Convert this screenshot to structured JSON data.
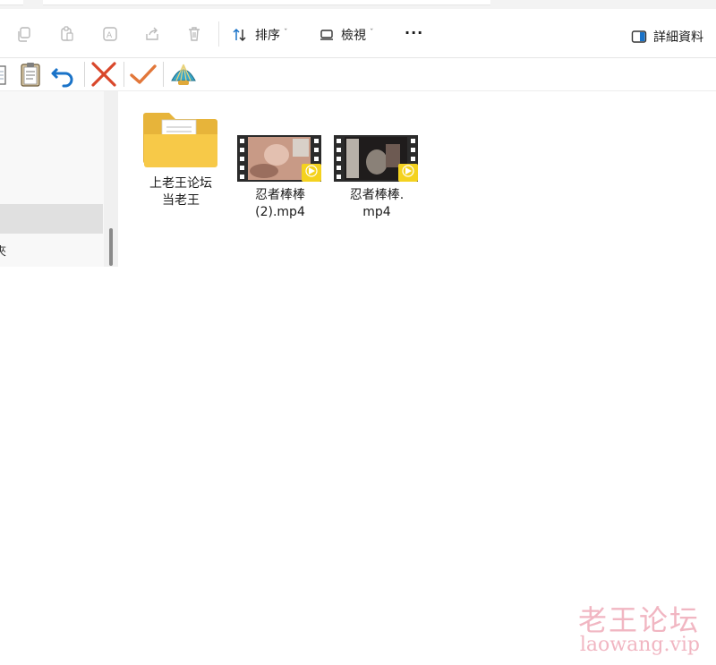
{
  "command_bar": {
    "sort_label": "排序",
    "view_label": "檢視",
    "more_label": "···",
    "details_label": "詳細資料",
    "chevron": "ˇ",
    "icons": [
      "copy-icon",
      "paste-icon",
      "rename-icon",
      "share-icon",
      "delete-icon"
    ]
  },
  "toolbar2": {
    "icons": [
      "document-icon",
      "clipboard-icon",
      "undo-icon",
      "close-x-icon",
      "checkmark-icon",
      "shell-icon"
    ]
  },
  "sidebar": {
    "partial_text": "夾"
  },
  "files": [
    {
      "name_line1": "上老王论坛",
      "name_line2": "当老王",
      "type": "folder"
    },
    {
      "name_line1": "忍者棒棒",
      "name_line2": "(2).mp4",
      "type": "video",
      "badge": "Player"
    },
    {
      "name_line1": "忍者棒棒.",
      "name_line2": "mp4",
      "type": "video",
      "badge": "Player"
    }
  ],
  "watermark": {
    "line1": "老王论坛",
    "line2": "laowang.vip"
  },
  "colors": {
    "accent_blue": "#1a73c8",
    "folder_yellow": "#f7c948",
    "cancel_red": "#d9472b",
    "ok_orange": "#e2773a",
    "watermark_pink": "#f1b6c2"
  }
}
